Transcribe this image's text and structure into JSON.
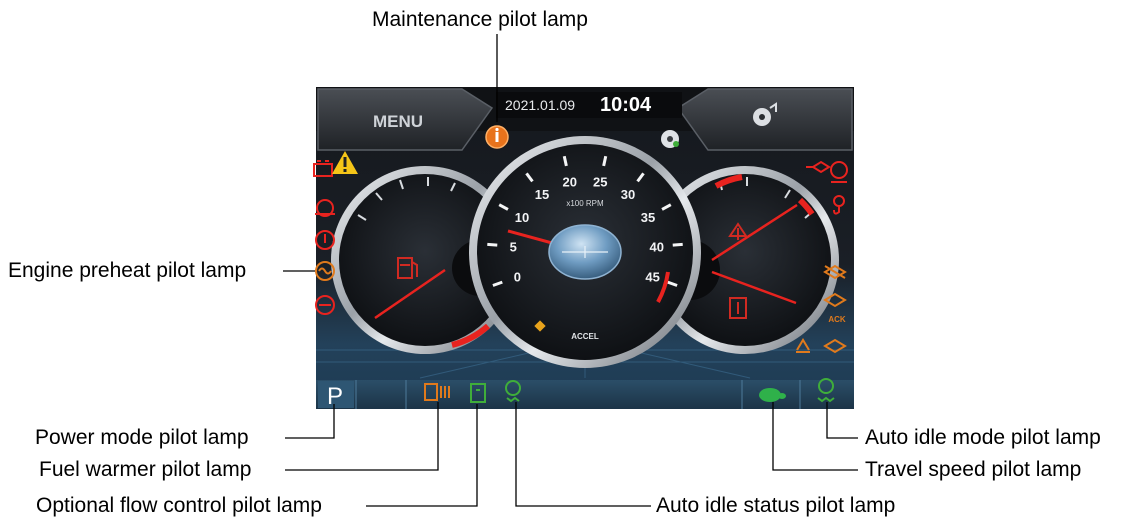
{
  "callouts": {
    "maintenance": "Maintenance pilot lamp",
    "engine_preheat": "Engine preheat pilot lamp",
    "power_mode": "Power mode pilot lamp",
    "fuel_warmer": "Fuel warmer pilot lamp",
    "optional_flow": "Optional flow control pilot lamp",
    "auto_idle_status": "Auto idle status pilot lamp",
    "auto_idle_mode": "Auto idle mode pilot lamp",
    "travel_speed": "Travel speed pilot lamp"
  },
  "display": {
    "menu_label": "MENU",
    "date": "2021.01.09",
    "time": "10:04",
    "power_mode_letter": "P",
    "rpm_unit": "x100 RPM",
    "accel_label": "ACCEL",
    "ack_label": "ACK"
  },
  "tachometer": {
    "ticks": [
      "0",
      "5",
      "10",
      "15",
      "20",
      "25",
      "30",
      "35",
      "40",
      "45"
    ]
  },
  "colors": {
    "warning_red": "#e8231f",
    "lamp_orange": "#e07a1c",
    "lamp_green": "#3fae3a",
    "screen_dark": "#0e1116"
  }
}
